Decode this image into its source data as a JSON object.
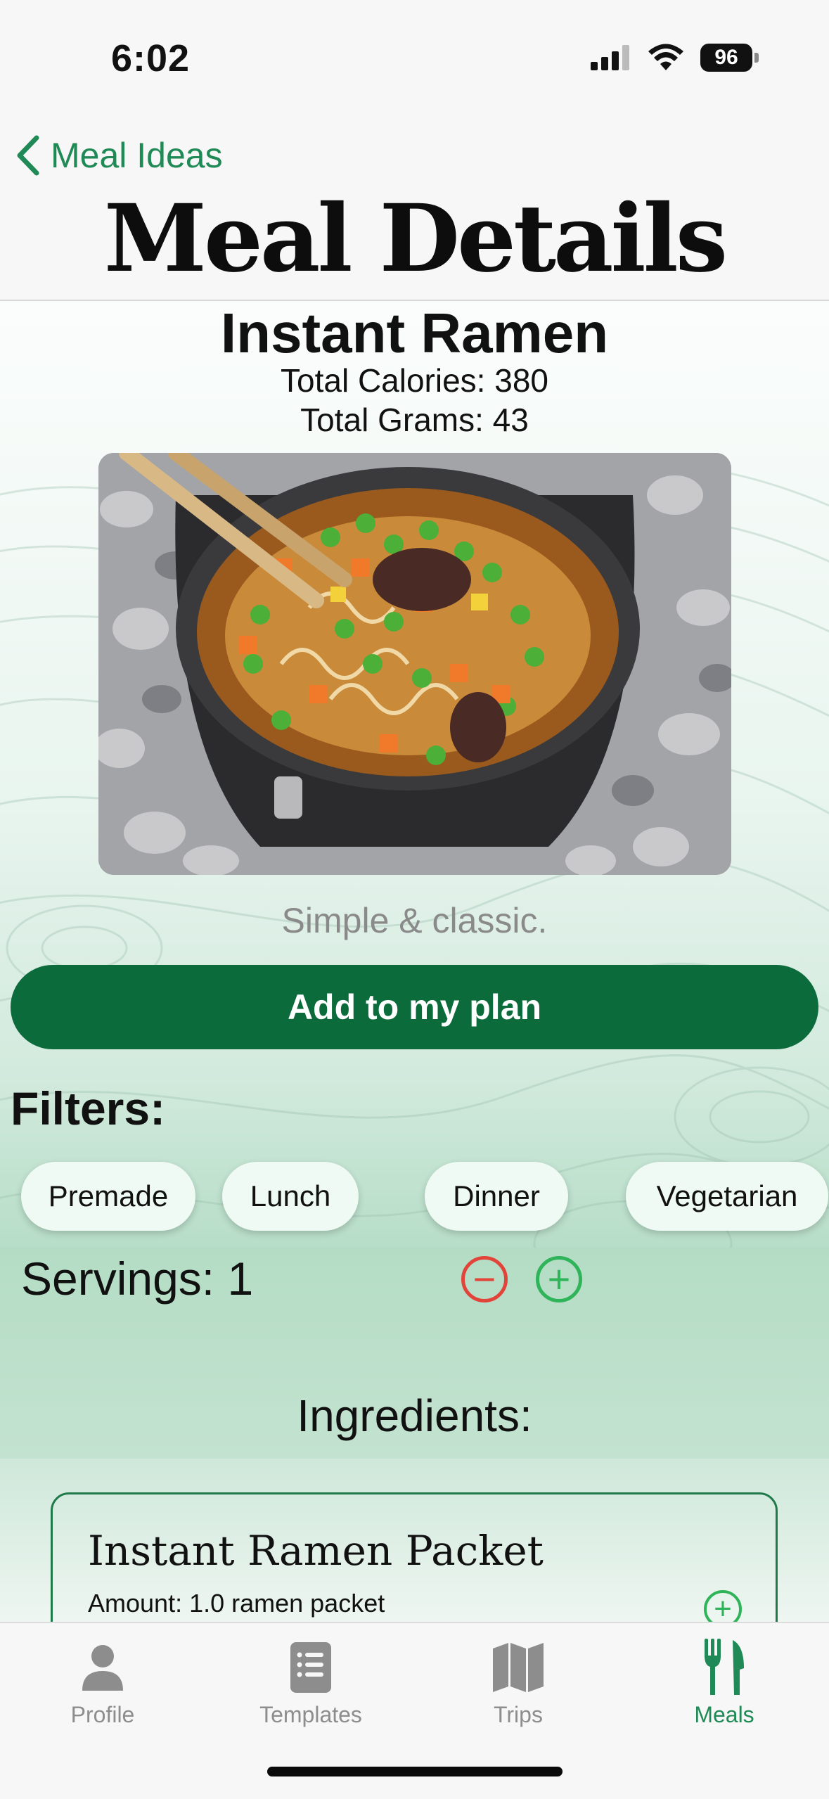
{
  "status_bar": {
    "time": "6:02",
    "battery": "96",
    "icons": [
      "signal-icon",
      "wifi-icon",
      "battery-icon"
    ]
  },
  "nav": {
    "back_label": "Meal Ideas",
    "title": "Meal Details"
  },
  "meal": {
    "name": "Instant Ramen",
    "calories": "Total Calories: 380",
    "grams": "Total Grams: 43",
    "description": "Simple & classic."
  },
  "actions": {
    "add_to_plan": "Add to my plan"
  },
  "filters": {
    "title": "Filters:",
    "chips": [
      "Premade",
      "Lunch",
      "Dinner",
      "Vegetarian"
    ]
  },
  "servings": {
    "label": "Servings: 1",
    "minus": "−",
    "plus": "+"
  },
  "ingredients": {
    "title": "Ingredients:",
    "items": [
      {
        "name": "Instant Ramen Packet",
        "amount": "Amount: 1.0 ramen packet"
      }
    ]
  },
  "tabbar": {
    "tabs": [
      {
        "label": "Profile",
        "icon": "person-icon"
      },
      {
        "label": "Templates",
        "icon": "list-icon"
      },
      {
        "label": "Trips",
        "icon": "map-icon"
      },
      {
        "label": "Meals",
        "icon": "fork-knife-icon"
      }
    ],
    "active": "Meals"
  },
  "colors": {
    "accent": "#1f8a55",
    "button": "#0b6b3a",
    "minus": "#e2443a",
    "plus": "#2fb45a"
  }
}
